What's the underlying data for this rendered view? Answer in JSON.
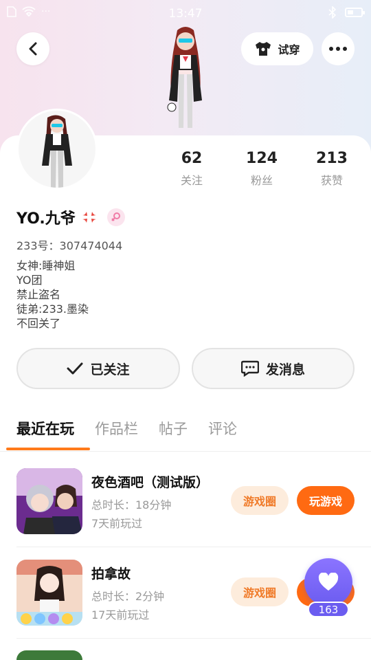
{
  "status_bar": {
    "time": "13:47",
    "left_text": "···"
  },
  "header": {
    "try_on_label": "试穿"
  },
  "profile": {
    "name": "YO.九爷",
    "uid": "233号：307474044",
    "bio_lines": [
      "女神:睡神姐",
      "YO团",
      "禁止盗名",
      "徒弟:233.墨染",
      "不回关了"
    ],
    "stats": [
      {
        "value": "62",
        "label": "关注"
      },
      {
        "value": "124",
        "label": "粉丝"
      },
      {
        "value": "213",
        "label": "获赞"
      }
    ]
  },
  "actions": {
    "follow_label": "已关注",
    "message_label": "发消息"
  },
  "tabs": [
    {
      "label": "最近在玩",
      "active": true
    },
    {
      "label": "作品栏",
      "active": false
    },
    {
      "label": "帖子",
      "active": false
    },
    {
      "label": "评论",
      "active": false
    }
  ],
  "games": [
    {
      "title": "夜色酒吧（测试版）",
      "duration": "总时长：18分钟",
      "last_played": "7天前玩过",
      "circle_label": "游戏圈",
      "play_label": "玩游戏"
    },
    {
      "title": "拍拿故",
      "duration": "总时长：2分钟",
      "last_played": "17天前玩过",
      "circle_label": "游戏圈",
      "play_label": "玩游戏"
    }
  ],
  "like_button": {
    "count": "163"
  },
  "colors": {
    "accent": "#ff6a12",
    "tab_underline": "#ff7a1a",
    "like_purple": "#6b5cf0"
  }
}
